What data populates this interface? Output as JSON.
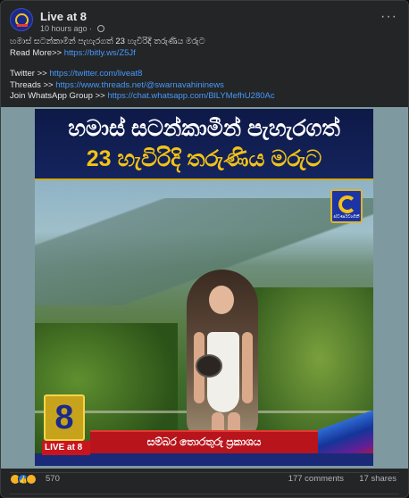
{
  "post": {
    "page_name": "Live at 8",
    "timestamp": "10 hours ago · ",
    "lines": {
      "title": "හමාස් සටන්කාමීන් පැහැරගත් 23 හැවිරිදි තරුණිය මරුට",
      "read_more_label": "Read More>> ",
      "read_more_link": "https://bitly.ws/Z5Jf",
      "twitter_label": "Twitter >> ",
      "twitter_link": "https://twitter.com/liveat8",
      "threads_label": "Threads >> ",
      "threads_link": "https://www.threads.net/@swarnavahininews",
      "whatsapp_label": "Join WhatsApp Group >> ",
      "whatsapp_link": "https://chat.whatsapp.com/BlLYMefhU280Ac"
    }
  },
  "image": {
    "headline_line1": "හමාස් සටන්කාමීන් පැහැරගත්",
    "headline_line2": "23 හැවිරිදි තරුණිය මරුට",
    "logo_right_text": "ස්වර්ණවාහිනී",
    "live_logo_digit": "8",
    "live_label": "LIVE at 8",
    "ticker_text": "සම්බර තොරතුරු ප්‍රකාශය"
  },
  "footer": {
    "reaction_count": "570",
    "comments": "177 comments",
    "shares": "17 shares"
  },
  "colors": {
    "background": "#242526",
    "link": "#4599ff",
    "headline_accent": "#f3c315",
    "ticker_red": "#b8141c"
  }
}
